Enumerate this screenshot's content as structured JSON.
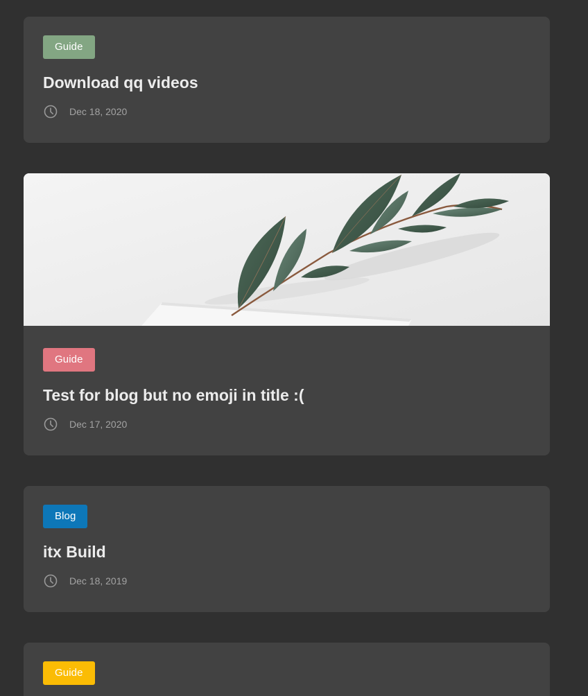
{
  "posts": [
    {
      "tag": "Guide",
      "tag_color": "#83a683",
      "title": "Download qq videos",
      "date": "Dec 18, 2020",
      "has_cover": false
    },
    {
      "tag": "Guide",
      "tag_color": "#e07680",
      "title": "Test for blog but no emoji in title :(",
      "date": "Dec 17, 2020",
      "has_cover": true,
      "cover_icon": "eucalyptus-branch-photo"
    },
    {
      "tag": "Blog",
      "tag_color": "#0d77b8",
      "title": "itx Build",
      "date": "Dec 18, 2019",
      "has_cover": false
    },
    {
      "tag": "Guide",
      "tag_color": "#fbbc05",
      "has_cover": false
    }
  ],
  "meta_icon": "clock-icon"
}
